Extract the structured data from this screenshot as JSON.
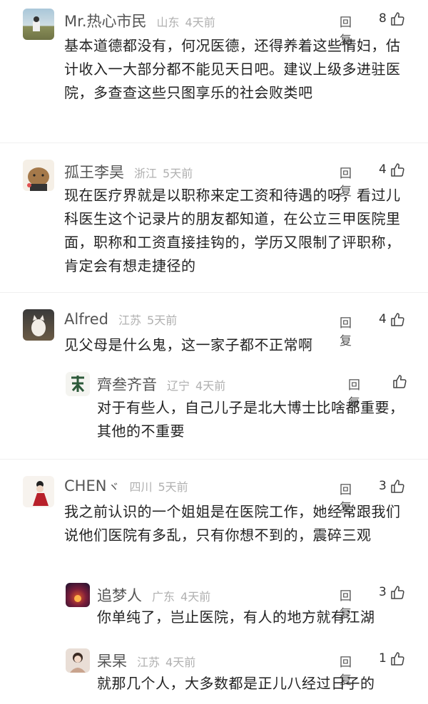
{
  "comments": [
    {
      "user": "Mr.热心市民",
      "location": "山东",
      "time": "4天前",
      "reply": "回复",
      "likes": "8",
      "text": "基本道德都没有，何况医德，还得养着这些情妇，估计收入一大部分都不能见天日吧。建议上级多进驻医院，多查查这些只图享乐的社会败类吧"
    },
    {
      "user": "孤王李昊",
      "location": "浙江",
      "time": "5天前",
      "reply": "回复",
      "likes": "4",
      "text": "现在医疗界就是以职称来定工资和待遇的呀，看过儿科医生这个记录片的朋友都知道，在公立三甲医院里面，职称和工资直接挂钩的，学历又限制了评职称，肯定会有想走捷径的"
    },
    {
      "user": "Alfred",
      "location": "江苏",
      "time": "5天前",
      "reply": "回复",
      "likes": "4",
      "text": "见父母是什么鬼，这一家子都不正常啊"
    },
    {
      "user": "齊叁齐音",
      "location": "辽宁",
      "time": "4天前",
      "reply": "回复",
      "likes": "",
      "text": "对于有些人，自己儿子是北大博士比啥都重要，其他的不重要"
    },
    {
      "user": "CHEN",
      "badge": "ヾ",
      "location": "四川",
      "time": "5天前",
      "reply": "回复",
      "likes": "3",
      "text": "我之前认识的一个姐姐是在医院工作，她经常跟我们说他们医院有多乱，只有你想不到的，震碎三观"
    },
    {
      "user": "追梦人",
      "location": "广东",
      "time": "4天前",
      "reply": "回复",
      "likes": "3",
      "text": "你单纯了，岂止医院，有人的地方就有江湖"
    },
    {
      "user": "杲杲",
      "location": "江苏",
      "time": "4天前",
      "reply": "回复",
      "likes": "1",
      "text": "就那几个人，大多数都是正儿八经过日子的"
    }
  ],
  "icons": {
    "like": "thumbs-up-icon"
  }
}
